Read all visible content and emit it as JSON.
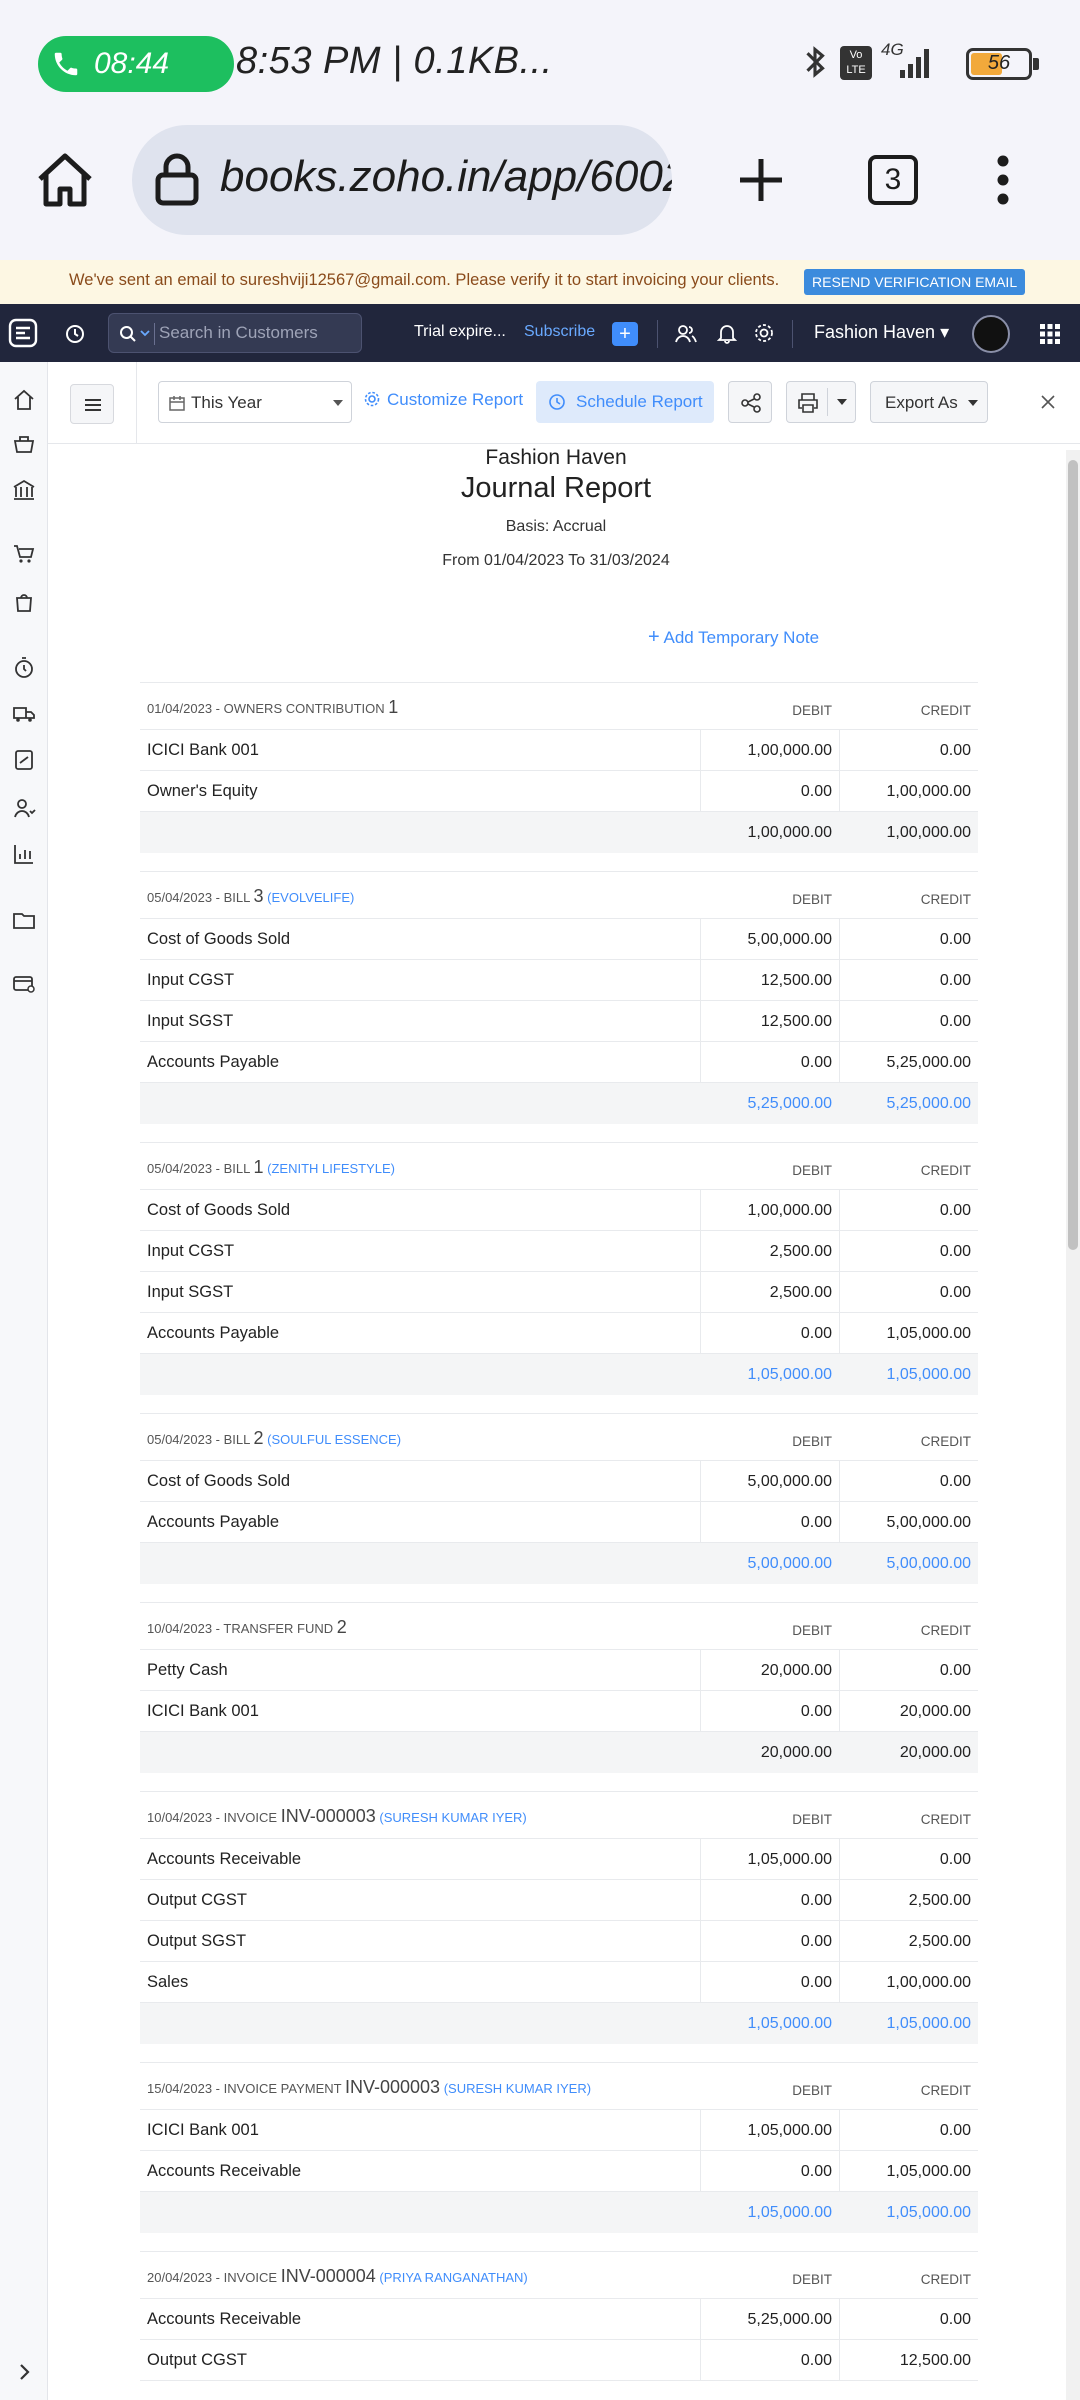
{
  "status_bar": {
    "call_time": "08:44",
    "text": "8:53 PM | 0.1KB...",
    "network": "4G",
    "volte": "Vo LTE",
    "battery": "56",
    "battery_level": 0.56
  },
  "browser": {
    "url": "books.zoho.in/app/6002",
    "tab_count": "3"
  },
  "banner": {
    "message": "We've sent an email to sureshviji12567@gmail.com. Please verify it to start invoicing your clients.",
    "button": "RESEND VERIFICATION EMAIL"
  },
  "topnav": {
    "search_placeholder": "Search in Customers",
    "trial": "Trial expire...",
    "subscribe": "Subscribe",
    "plus": "+",
    "org": "Fashion Haven"
  },
  "toolbar": {
    "period": "This Year",
    "customize": "Customize Report",
    "schedule": "Schedule Report",
    "export": "Export As"
  },
  "report": {
    "org": "Fashion Haven",
    "title": "Journal Report",
    "basis": "Basis: Accrual",
    "range": "From 01/04/2023 To 31/03/2024",
    "add_note": "Add Temporary Note",
    "debit_label": "DEBIT",
    "credit_label": "CREDIT",
    "entries": [
      {
        "prefix": "01/04/2023 - OWNERS CONTRIBUTION",
        "number": "1",
        "party": "",
        "linked_totals": false,
        "rows": [
          {
            "account": "ICICI Bank 001",
            "debit": "1,00,000.00",
            "credit": "0.00"
          },
          {
            "account": "Owner's Equity",
            "debit": "0.00",
            "credit": "1,00,000.00"
          }
        ],
        "total_debit": "1,00,000.00",
        "total_credit": "1,00,000.00"
      },
      {
        "prefix": "05/04/2023 - BILL",
        "number": "3",
        "party": "(EVOLVELIFE)",
        "linked_totals": true,
        "rows": [
          {
            "account": "Cost of Goods Sold",
            "debit": "5,00,000.00",
            "credit": "0.00"
          },
          {
            "account": "Input CGST",
            "debit": "12,500.00",
            "credit": "0.00"
          },
          {
            "account": "Input SGST",
            "debit": "12,500.00",
            "credit": "0.00"
          },
          {
            "account": "Accounts Payable",
            "debit": "0.00",
            "credit": "5,25,000.00"
          }
        ],
        "total_debit": "5,25,000.00",
        "total_credit": "5,25,000.00"
      },
      {
        "prefix": "05/04/2023 - BILL",
        "number": "1",
        "party": "(ZENITH LIFESTYLE)",
        "linked_totals": true,
        "rows": [
          {
            "account": "Cost of Goods Sold",
            "debit": "1,00,000.00",
            "credit": "0.00"
          },
          {
            "account": "Input CGST",
            "debit": "2,500.00",
            "credit": "0.00"
          },
          {
            "account": "Input SGST",
            "debit": "2,500.00",
            "credit": "0.00"
          },
          {
            "account": "Accounts Payable",
            "debit": "0.00",
            "credit": "1,05,000.00"
          }
        ],
        "total_debit": "1,05,000.00",
        "total_credit": "1,05,000.00"
      },
      {
        "prefix": "05/04/2023 - BILL",
        "number": "2",
        "party": "(SOULFUL ESSENCE)",
        "linked_totals": true,
        "rows": [
          {
            "account": "Cost of Goods Sold",
            "debit": "5,00,000.00",
            "credit": "0.00"
          },
          {
            "account": "Accounts Payable",
            "debit": "0.00",
            "credit": "5,00,000.00"
          }
        ],
        "total_debit": "5,00,000.00",
        "total_credit": "5,00,000.00"
      },
      {
        "prefix": "10/04/2023 - TRANSFER FUND",
        "number": "2",
        "party": "",
        "linked_totals": false,
        "rows": [
          {
            "account": "Petty Cash",
            "debit": "20,000.00",
            "credit": "0.00"
          },
          {
            "account": "ICICI Bank 001",
            "debit": "0.00",
            "credit": "20,000.00"
          }
        ],
        "total_debit": "20,000.00",
        "total_credit": "20,000.00"
      },
      {
        "prefix": "10/04/2023 - INVOICE",
        "number": "INV-000003",
        "party": "(SURESH KUMAR IYER)",
        "linked_totals": true,
        "rows": [
          {
            "account": "Accounts Receivable",
            "debit": "1,05,000.00",
            "credit": "0.00"
          },
          {
            "account": "Output CGST",
            "debit": "0.00",
            "credit": "2,500.00"
          },
          {
            "account": "Output SGST",
            "debit": "0.00",
            "credit": "2,500.00"
          },
          {
            "account": "Sales",
            "debit": "0.00",
            "credit": "1,00,000.00"
          }
        ],
        "total_debit": "1,05,000.00",
        "total_credit": "1,05,000.00"
      },
      {
        "prefix": "15/04/2023 - INVOICE PAYMENT",
        "number": "INV-000003",
        "party": "(SURESH KUMAR IYER)",
        "linked_totals": true,
        "rows": [
          {
            "account": "ICICI Bank 001",
            "debit": "1,05,000.00",
            "credit": "0.00"
          },
          {
            "account": "Accounts Receivable",
            "debit": "0.00",
            "credit": "1,05,000.00"
          }
        ],
        "total_debit": "1,05,000.00",
        "total_credit": "1,05,000.00"
      },
      {
        "prefix": "20/04/2023 - INVOICE",
        "number": "INV-000004",
        "party": "(PRIYA RANGANATHAN)",
        "linked_totals": true,
        "rows": [
          {
            "account": "Accounts Receivable",
            "debit": "5,25,000.00",
            "credit": "0.00"
          },
          {
            "account": "Output CGST",
            "debit": "0.00",
            "credit": "12,500.00"
          }
        ],
        "total_debit": "",
        "total_credit": ""
      }
    ]
  }
}
